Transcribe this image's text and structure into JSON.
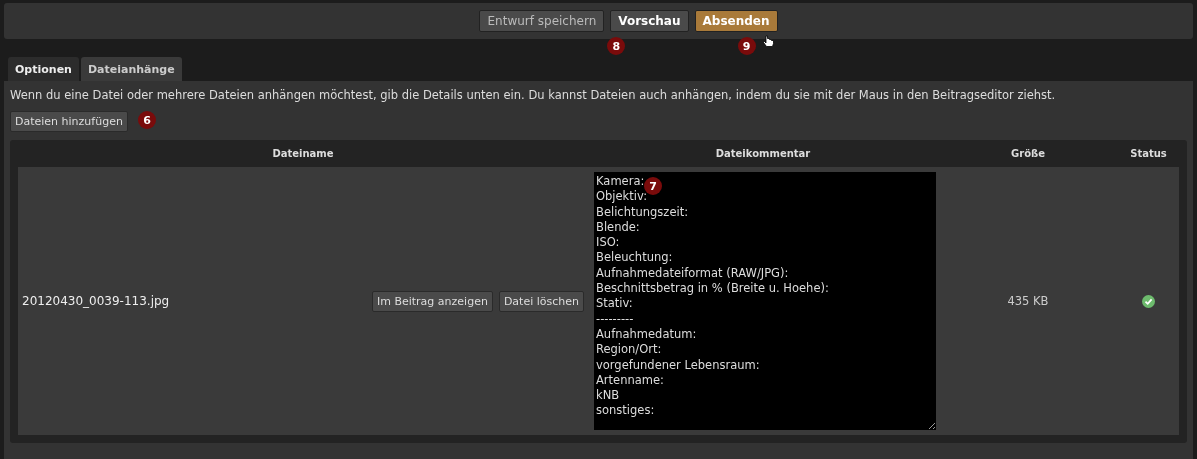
{
  "toolbar": {
    "buttons": [
      {
        "label": "Entwurf speichern",
        "kind": "plain"
      },
      {
        "label": "Vorschau",
        "kind": "bold",
        "badge": "8"
      },
      {
        "label": "Absenden",
        "kind": "primary",
        "badge": "9"
      }
    ]
  },
  "tabs": [
    {
      "label": "Optionen",
      "selected": false
    },
    {
      "label": "Dateianhänge",
      "selected": true
    }
  ],
  "intro": "Wenn du eine Datei oder mehrere Dateien anhängen möchtest, gib die Details unten ein. Du kannst Dateien auch anhängen, indem du sie mit der Maus in den Beitragseditor ziehst.",
  "add_button": {
    "label": "Dateien hinzufügen",
    "badge": "6"
  },
  "table": {
    "columns": [
      "Dateiname",
      "Dateikommentar",
      "Größe",
      "Status"
    ],
    "rows": [
      {
        "filename": "20120430_0039-113.jpg",
        "actions": [
          "Im Beitrag anzeigen",
          "Datei löschen"
        ],
        "comment_badge": "7",
        "comment": [
          "Kamera:",
          "Objektiv:",
          "Belichtungszeit:",
          "Blende:",
          "ISO:",
          "Beleuchtung:",
          "Aufnahmedateiformat (RAW/JPG):",
          "Beschnittsbetrag in % (Breite u. Hoehe):",
          "Stativ:",
          "---------",
          "Aufnahmedatum:",
          "Region/Ort:",
          "vorgefundener Lebensraum:",
          "Artenname:",
          "kNB",
          "sonstiges:"
        ],
        "size": "435 KB",
        "uploaded": true
      }
    ]
  }
}
